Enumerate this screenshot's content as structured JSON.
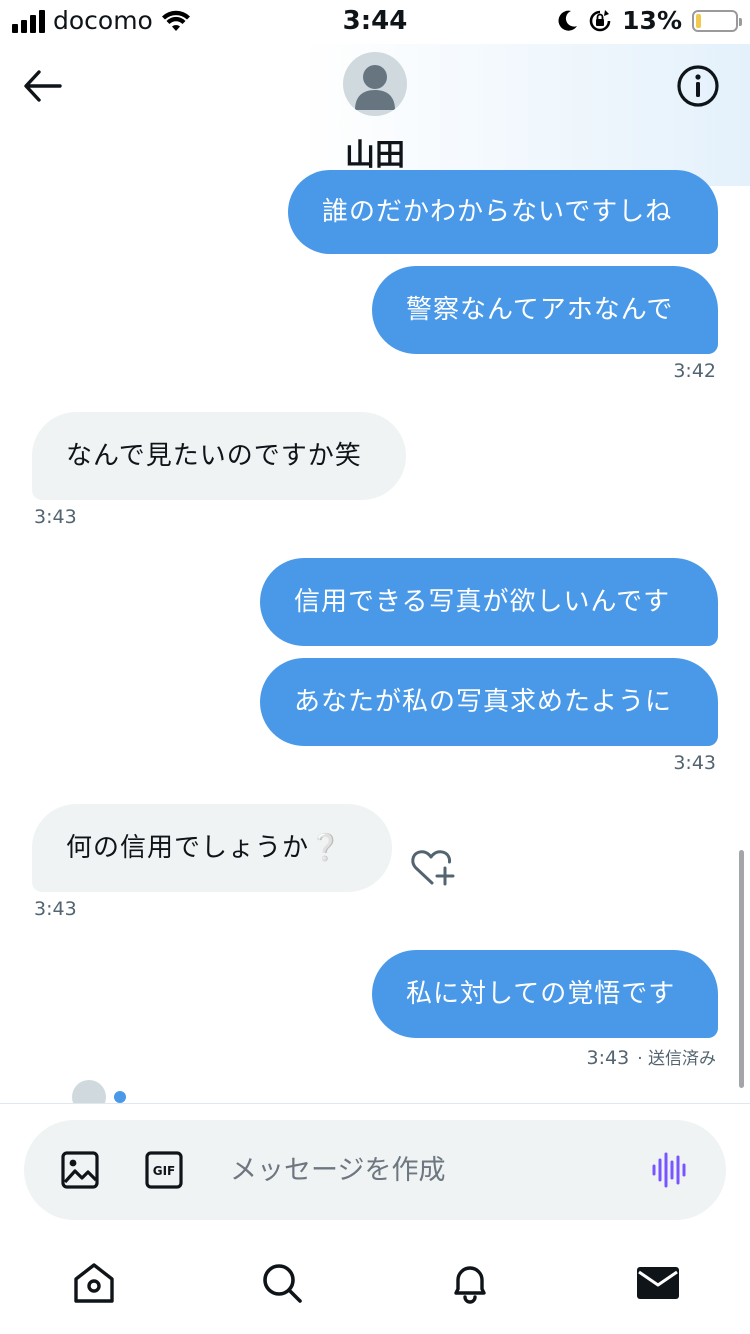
{
  "status_bar": {
    "carrier": "docomo",
    "time": "3:44",
    "battery_percent": "13%",
    "battery_level": 0.13
  },
  "header": {
    "contact_name": "山田"
  },
  "messages": [
    {
      "side": "sent",
      "text": "誰のだかわからないですしね"
    },
    {
      "side": "sent",
      "text": "警察なんてアホなんで",
      "time": "3:42"
    },
    {
      "side": "received",
      "text": "なんで見たいのですか笑",
      "time": "3:43"
    },
    {
      "side": "sent",
      "text": "信用できる写真が欲しいんです"
    },
    {
      "side": "sent",
      "text": "あなたが私の写真求めたように",
      "time": "3:43"
    },
    {
      "side": "received",
      "text": "何の信用でしょうか❔",
      "time": "3:43"
    },
    {
      "side": "sent",
      "text": "私に対しての覚悟です",
      "time": "3:43",
      "status": "· 送信済み"
    }
  ],
  "composer": {
    "placeholder": "メッセージを作成"
  },
  "colors": {
    "sent_bubble": "#4a99e9",
    "received_bubble": "#eff3f4",
    "voice_accent": "#7856ff"
  }
}
